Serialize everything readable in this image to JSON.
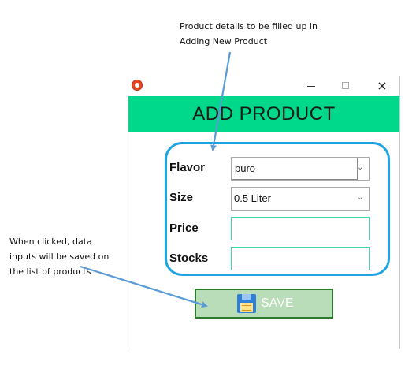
{
  "annotations": {
    "top_note": {
      "line1": "Product details to be filled up in",
      "line2": "Adding New Product"
    },
    "left_note": {
      "line1": "When clicked, data",
      "line2": "inputs will be saved on",
      "line3": "the list of products"
    },
    "arrow_color": "#5b9bd5"
  },
  "window": {
    "app_icon": "app-logo-icon",
    "controls": {
      "minimize": "minimize-icon",
      "maximize": "maximize-icon",
      "close": "×"
    },
    "header": {
      "title": "ADD PRODUCT",
      "color": "#00d98b"
    },
    "form": {
      "border_color": "#1ea4e2",
      "flavor": {
        "label": "Flavor",
        "value": "puro"
      },
      "size": {
        "label": "Size",
        "value": "0.5 Liter"
      },
      "price": {
        "label": "Price",
        "value": ""
      },
      "stocks": {
        "label": "Stocks",
        "value": ""
      }
    },
    "save_button": {
      "label": "SAVE",
      "icon": "floppy-disk-icon",
      "color": "#b9dcb9"
    }
  }
}
